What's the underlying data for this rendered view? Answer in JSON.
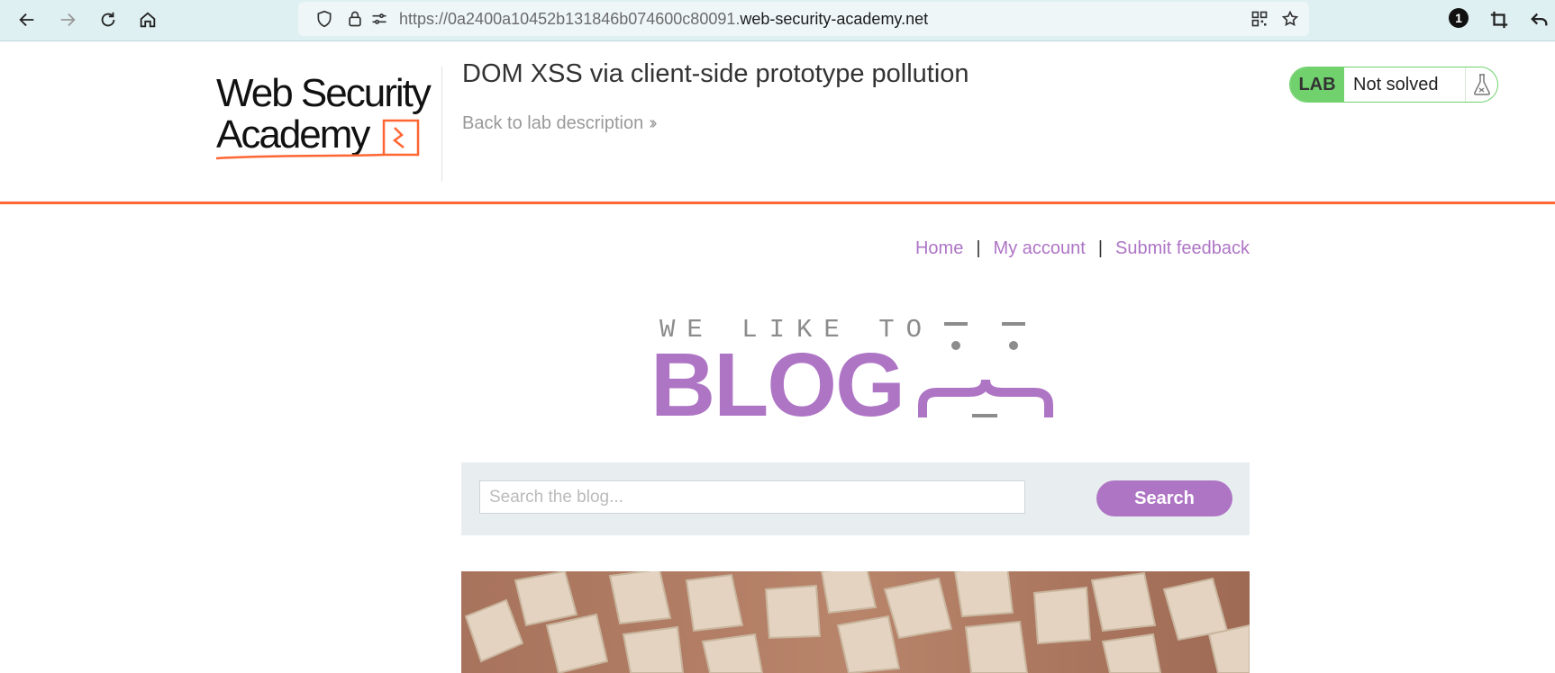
{
  "browser": {
    "url_prefix": "https://0a2400a10452b131846b074600c80091.",
    "url_host": "web-security-academy.net",
    "notification_count": "1",
    "icons": [
      "back-arrow-icon",
      "forward-arrow-icon",
      "reload-icon",
      "home-icon",
      "shield-icon",
      "lock-icon",
      "site-permissions-icon",
      "qr-code-icon",
      "bookmark-star-icon",
      "extension-badge-icon",
      "crop-screenshot-icon",
      "undo-arrow-icon"
    ]
  },
  "lab": {
    "logo_line1": "Web Security",
    "logo_line2": "Academy",
    "title": "DOM XSS via client-side prototype pollution",
    "back_link": "Back to lab description",
    "status_tag": "LAB",
    "status_text": "Not solved",
    "accent_color": "#ff6633",
    "status_color": "#70d16d"
  },
  "nav": {
    "home": "Home",
    "separator": "|",
    "my_account": "My account",
    "submit_feedback": "Submit feedback",
    "link_color": "#ae75c5"
  },
  "banner": {
    "tagline": "WE LIKE TO",
    "word": "BLOG"
  },
  "search": {
    "placeholder": "Search the blog...",
    "value": "",
    "button_label": "Search",
    "button_color": "#ae75c5"
  },
  "post": {
    "image_subject": "wooden-blocks-photo"
  }
}
